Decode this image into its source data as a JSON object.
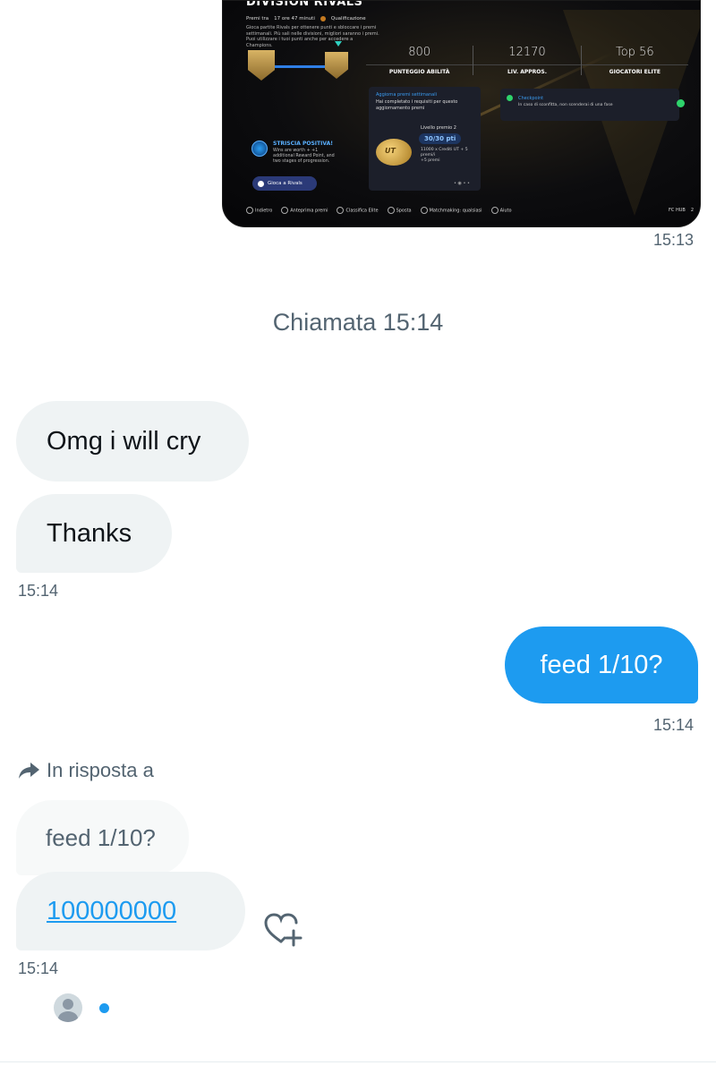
{
  "screenshot": {
    "title": "DIVISION RIVALS",
    "premi_tra": "Premi tra",
    "timer": "17 ore 47 minuti",
    "stage": "Qualificazione",
    "description": "Gioca partite Rivals per ottenere punti e sbloccare i premi settimanali. Più sali nelle divisioni, migliori saranno i premi. Puoi utilizzare i tuoi punti anche per accedere a Champions.",
    "stats": [
      {
        "value": "800",
        "label": "PUNTEGGIO ABILITÀ"
      },
      {
        "value": "12170",
        "label": "LIV. APPROS."
      },
      {
        "value": "Top 56",
        "label": "GIOCATORI ELITE"
      }
    ],
    "weekly_card": {
      "heading": "Aggiorna premi settimanali",
      "text": "Hai completato i requisiti per questo aggiornamento premi",
      "level": "Livello premio 2",
      "points": "30/30 pti",
      "coin_label": "UT",
      "rewards": "11000 x Crediti UT + 5 premi/i",
      "extra": "+5 premi"
    },
    "checkpoint_card": {
      "heading": "Checkpoint",
      "text": "In caso di sconfitta, non scenderai di una fase"
    },
    "streak": {
      "heading": "STRISCIA POSITIVA!",
      "text": "Wins are worth + +1 additional Reward Point, and two stages of progression."
    },
    "play_button": "Gioca a Rivals",
    "footer": {
      "back": "Indietro",
      "preview": "Anteprima premi",
      "elite": "Classifica Elite",
      "move": "Sposta",
      "matchmaking": "Matchmaking: qualsiasi",
      "help": "Aiuto",
      "hub": "FC HUB",
      "count": "2"
    }
  },
  "chat": {
    "image_time": "15:13",
    "call_label": "Chiamata 15:14",
    "msg1": "Omg i will cry",
    "msg2": "Thanks",
    "time_received_1": "15:14",
    "msg_sent": "feed 1/10?",
    "time_sent": "15:14",
    "reply_label": "In risposta a",
    "quoted_text": "feed 1/10?",
    "msg3": "100000000",
    "time_received_2": "15:14"
  },
  "colors": {
    "accent": "#1d9bf0",
    "bubble_in": "#eff3f4",
    "muted_text": "#536471"
  },
  "icons": [
    "reply-arrow-icon",
    "add-reaction-icon",
    "avatar-icon",
    "typing-dot-icon"
  ]
}
